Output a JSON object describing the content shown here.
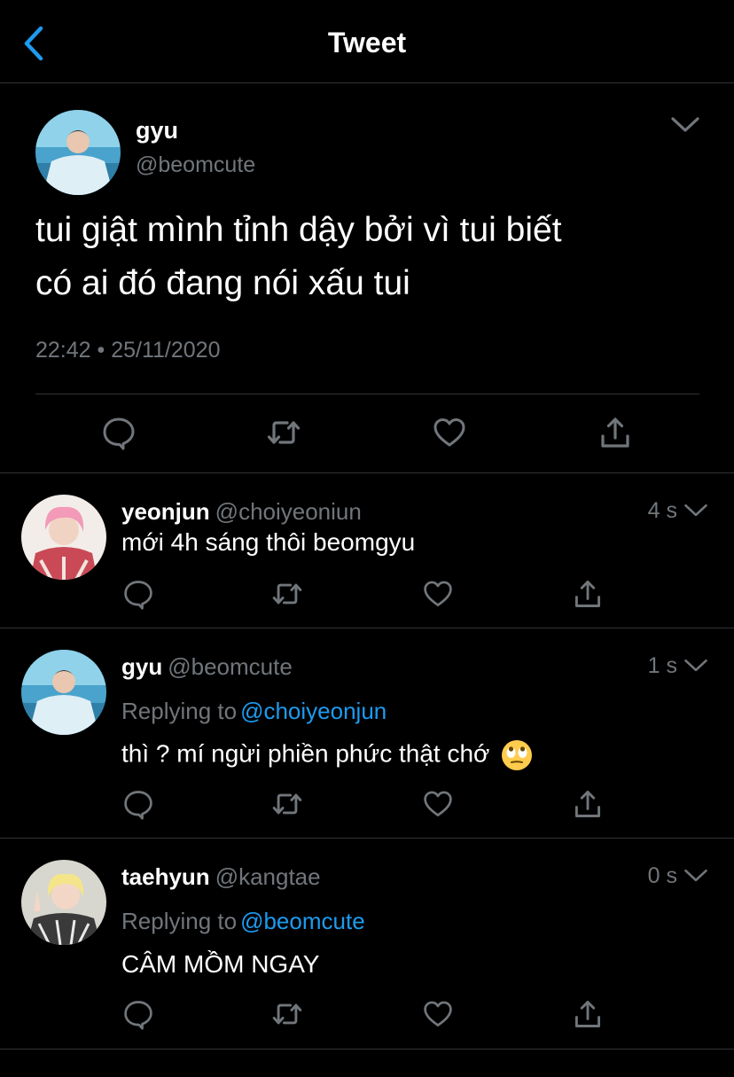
{
  "header": {
    "title": "Tweet",
    "back_icon": "chevron-left-icon"
  },
  "colors": {
    "background": "#000000",
    "accent": "#1d9bf0",
    "secondary_text": "#71767b",
    "divider": "#2f3336"
  },
  "main_tweet": {
    "name": "gyu",
    "handle": "@beomcute",
    "text_line1": "tui giật mình tỉnh dậy bởi vì tui biết",
    "text_line2": "có ai đó đang nói xấu tui",
    "timestamp": "22:42 • 25/11/2020",
    "actions": [
      "reply-icon",
      "retweet-icon",
      "like-icon",
      "share-icon"
    ]
  },
  "replies": [
    {
      "name": "yeonjun",
      "handle": "@choiyeoniun",
      "time": "4 s",
      "replying_label": "",
      "replying_to": "",
      "text": "mới 4h sáng thôi beomgyu"
    },
    {
      "name": "gyu",
      "handle": "@beomcute",
      "time": "1 s",
      "replying_label": "Replying to",
      "replying_to": "@choiyeonjun",
      "text": "thì ? mí ngừi phiền phức thật chớ",
      "emoji": "face-with-rolling-eyes"
    },
    {
      "name": "taehyun",
      "handle": "@kangtae",
      "time": "0 s",
      "replying_label": "Replying to",
      "replying_to": "@beomcute",
      "text": "CÂM MỒM NGAY"
    }
  ]
}
